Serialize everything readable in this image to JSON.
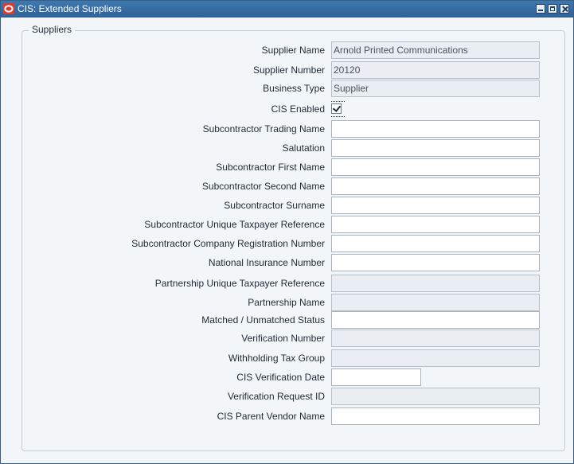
{
  "window": {
    "title": "CIS: Extended Suppliers"
  },
  "group": {
    "legend": "Suppliers"
  },
  "fields": [
    {
      "label": "Supplier Name",
      "value": "Arnold Printed Communications",
      "readonly": true
    },
    {
      "label": "Supplier Number",
      "value": "20120",
      "readonly": true
    },
    {
      "label": "Business Type",
      "value": "Supplier",
      "readonly": true
    },
    {
      "label": "CIS Enabled",
      "checked": true
    },
    {
      "label": "Subcontractor Trading Name",
      "value": "",
      "readonly": false
    },
    {
      "label": "Salutation",
      "value": "",
      "readonly": false
    },
    {
      "label": "Subcontractor First Name",
      "value": "",
      "readonly": false
    },
    {
      "label": "Subcontractor Second Name",
      "value": "",
      "readonly": false
    },
    {
      "label": "Subcontractor Surname",
      "value": "",
      "readonly": false
    },
    {
      "label": "Subcontractor Unique Taxpayer Reference",
      "value": "",
      "readonly": false
    },
    {
      "label": "Subcontractor Company Registration Number",
      "value": "",
      "readonly": false
    },
    {
      "label": "National Insurance Number",
      "value": "",
      "readonly": false
    },
    {
      "label": "Partnership Unique Taxpayer Reference",
      "value": "",
      "readonly": true
    },
    {
      "label": "Partnership Name",
      "value": "",
      "readonly": true
    },
    {
      "label": "Matched / Unmatched Status",
      "value": "",
      "readonly": false
    },
    {
      "label": "Verification Number",
      "value": "",
      "readonly": true
    },
    {
      "label": "Withholding Tax Group",
      "value": "",
      "readonly": true
    },
    {
      "label": "CIS Verification Date",
      "value": "",
      "readonly": false
    },
    {
      "label": "Verification Request ID",
      "value": "",
      "readonly": true
    },
    {
      "label": "CIS Parent Vendor Name",
      "value": "",
      "readonly": false
    }
  ],
  "colors": {
    "titlebar": "#2e6198",
    "readonly_field": "#eaedf1",
    "editable_field": "#ffffff"
  },
  "icons": {
    "app": "oracle-logo-icon",
    "minimize": "minimize-icon",
    "maximize": "maximize-icon",
    "close": "close-icon"
  }
}
